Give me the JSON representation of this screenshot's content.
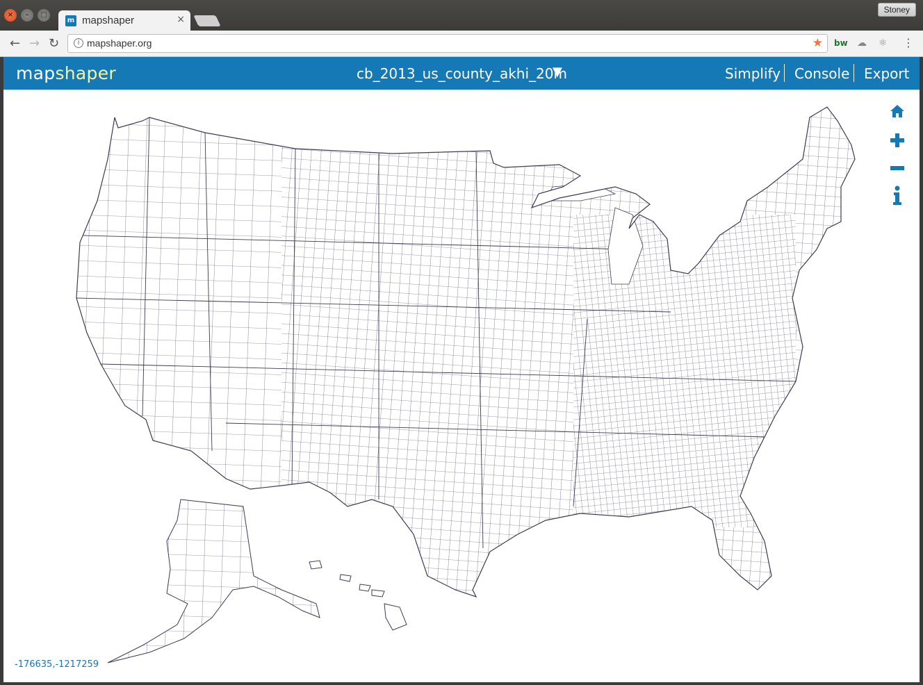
{
  "browser": {
    "tab_title": "mapshaper",
    "tab_favicon_text": "m",
    "tab_close": "×",
    "user_name": "Stoney",
    "url": "mapshaper.org",
    "back": "←",
    "forward": "→",
    "reload": "↻",
    "bookmark_star": "★",
    "extensions": [
      "bw",
      "cloud-icon",
      "react-icon"
    ],
    "menu": "⋮"
  },
  "app": {
    "logo_part1": "map",
    "logo_part2": "shaper",
    "layer_name": "cb_2013_us_county_akhi_20m",
    "layer_arrow": "▼",
    "menu": {
      "simplify": "Simplify",
      "console": "Console",
      "export": "Export"
    },
    "map_tools": [
      "home-icon",
      "zoom-in-icon",
      "zoom-out-icon",
      "info-icon"
    ],
    "coordinates": "-176635,-1217259",
    "colors": {
      "header": "#1479b5",
      "logo_accent": "#f5f2a8",
      "map_stroke": "#3b3b55",
      "tool_icon": "#1479b5"
    }
  }
}
